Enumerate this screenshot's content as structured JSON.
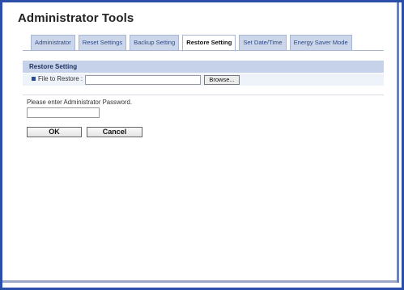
{
  "page": {
    "title": "Administrator Tools"
  },
  "tabs": [
    {
      "label": "Administrator",
      "active": false
    },
    {
      "label": "Reset Settings",
      "active": false
    },
    {
      "label": "Backup Setting",
      "active": false
    },
    {
      "label": "Restore Setting",
      "active": true
    },
    {
      "label": "Set Date/Time",
      "active": false
    },
    {
      "label": "Energy Saver Mode",
      "active": false
    }
  ],
  "restore": {
    "section_title": "Restore Setting",
    "file_label": "File to Restore",
    "separator": ":",
    "file_value": "",
    "browse_label": "Browse..."
  },
  "password": {
    "prompt": "Please enter Administrator Password.",
    "value": ""
  },
  "actions": {
    "ok_label": "OK",
    "cancel_label": "Cancel"
  },
  "colors": {
    "frame_border": "#2b4fa8",
    "tab_bg": "#ccd6ea",
    "tab_text": "#2f4a85",
    "section_bar": "#c6d2ea",
    "bullet": "#2a4c9a"
  },
  "icons": {
    "field_bullet": "square-bullet-icon"
  }
}
